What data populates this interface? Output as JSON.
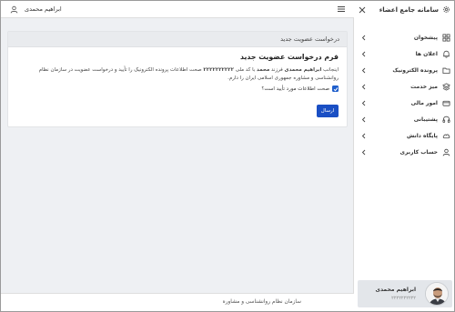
{
  "topbar": {
    "user_name": "ابراهیم محمدی"
  },
  "card": {
    "header": "درخواست عضویت جدید",
    "title": "فرم درخواست عضویت جدید",
    "desc_prefix": "اینجانب",
    "desc_name": "ابراهیم محمدی",
    "desc_mid1": "فرزند",
    "desc_father": "محمد",
    "desc_mid2": "با کد ملی",
    "desc_code": "۲۲۲۲۲۲۲۲۲۲",
    "desc_rest": "صحت اطلاعات پرونده الکترونیک را تأیید و درخواست عضویت در سازمان نظام روانشناسی و مشاوره جمهوری اسلامی ایران را دارم.",
    "checkbox_label": "صحت اطلاعات مورد تأیید است؟",
    "submit_label": "ارسال"
  },
  "footer": {
    "text": "سازمان نظام روانشناسی و مشاوره"
  },
  "sidebar": {
    "brand": "سامانه جامع اعضاء",
    "items": [
      {
        "label": "پیشخوان",
        "icon": "dashboard-icon"
      },
      {
        "label": "اعلان ها",
        "icon": "bell-icon"
      },
      {
        "label": "پرونده الکترونیک",
        "icon": "folder-icon"
      },
      {
        "label": "میز خدمت",
        "icon": "layers-icon"
      },
      {
        "label": "امور مالی",
        "icon": "wallet-icon"
      },
      {
        "label": "پشتیبانی",
        "icon": "headset-icon"
      },
      {
        "label": "پایگاه دانش",
        "icon": "cloud-icon"
      },
      {
        "label": "حساب کاربری",
        "icon": "user-icon"
      }
    ]
  },
  "profile": {
    "name": "ابراهیم محمدی",
    "id": "۲۲۲۲۲۲۲۲۲۲"
  },
  "colors": {
    "accent": "#1a4fc4",
    "background": "#eef0f3",
    "card_header": "#e9ebee",
    "profile_bg": "#e3e6ea"
  }
}
